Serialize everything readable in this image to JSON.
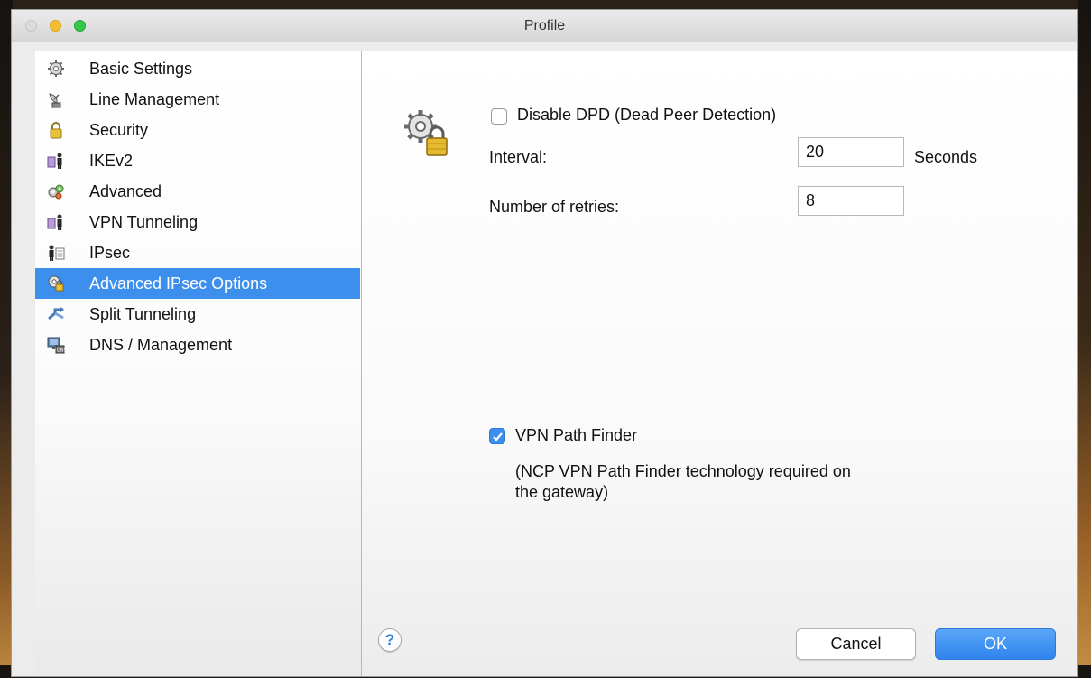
{
  "window": {
    "title": "Profile"
  },
  "sidebar": {
    "items": [
      {
        "label": "Basic Settings",
        "icon": "gear-icon"
      },
      {
        "label": "Line Management",
        "icon": "satellite-dish-icon"
      },
      {
        "label": "Security",
        "icon": "padlock-icon"
      },
      {
        "label": "IKEv2",
        "icon": "users-icon"
      },
      {
        "label": "Advanced",
        "icon": "gears-icon"
      },
      {
        "label": "VPN Tunneling",
        "icon": "users-icon"
      },
      {
        "label": "IPsec",
        "icon": "person-document-icon"
      },
      {
        "label": "Advanced IPsec Options",
        "icon": "gear-lock-icon",
        "selected": true
      },
      {
        "label": "Split Tunneling",
        "icon": "split-arrows-icon"
      },
      {
        "label": "DNS / Management",
        "icon": "network-dns-icon"
      }
    ]
  },
  "dpd": {
    "checkbox_label": "Disable DPD (Dead Peer Detection)",
    "checked": false,
    "interval_label": "Interval:",
    "interval_value": "20",
    "interval_unit": "Seconds",
    "retries_label": "Number of retries:",
    "retries_value": "8"
  },
  "path_finder": {
    "checkbox_label": "VPN Path Finder",
    "checked": true,
    "note_line1": "(NCP VPN Path Finder technology required on",
    "note_line2": "the gateway)"
  },
  "buttons": {
    "help": "?",
    "cancel": "Cancel",
    "ok": "OK"
  },
  "colors": {
    "accent": "#3d8fee",
    "selection": "#3d8fee"
  }
}
